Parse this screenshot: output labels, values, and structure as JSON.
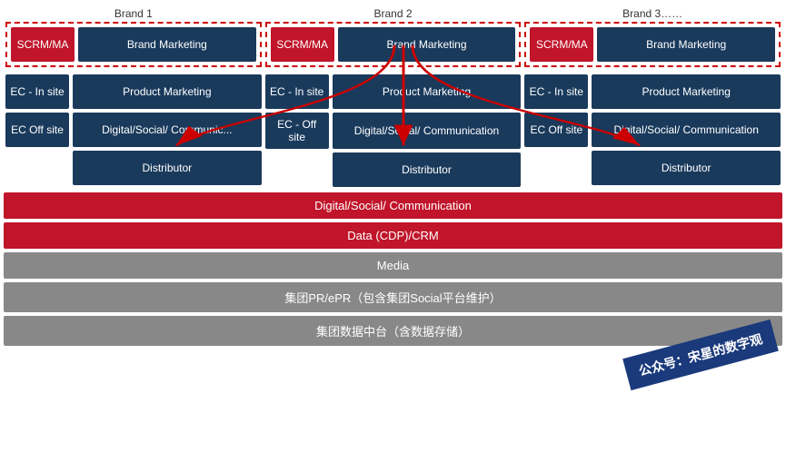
{
  "brands": [
    {
      "label": "Brand 1",
      "scrm": "SCRM/MA",
      "brandMarketing": "Brand Marketing",
      "ecInSite": "EC - In site",
      "productMarketing": "Product Marketing",
      "ecOffSite": "EC Off site",
      "digitalSocial": "Digital/Social/ Communication...",
      "distributor": "Distributor"
    },
    {
      "label": "Brand 2",
      "scrm": "SCRM/MA",
      "brandMarketing": "Brand Marketing",
      "ecInSite": "EC - In site",
      "productMarketing": "Product Marketing",
      "ecOffSite": "EC - Off site",
      "digitalSocial": "Digital/Social/ Communication",
      "distributor": "Distributor"
    },
    {
      "label": "Brand 3……",
      "scrm": "SCRM/MA",
      "brandMarketing": "Brand Marketing",
      "ecInSite": "EC - In site",
      "productMarketing": "Product Marketing",
      "ecOffSite": "EC Off site",
      "digitalSocial": "Digital/Social/ Communication",
      "distributor": "Distributor"
    }
  ],
  "bottomBars": [
    {
      "text": "Digital/Social/ Communication",
      "color": "red"
    },
    {
      "text": "Data (CDP)/CRM",
      "color": "red"
    },
    {
      "text": "Media",
      "color": "gray"
    },
    {
      "text": "集团PR/ePR（包含集团Social平台维护）",
      "color": "gray"
    },
    {
      "text": "集团数据中台（含数据存储）",
      "color": "gray"
    }
  ],
  "watermark": {
    "line1": "公众号：宋星的数字观"
  }
}
